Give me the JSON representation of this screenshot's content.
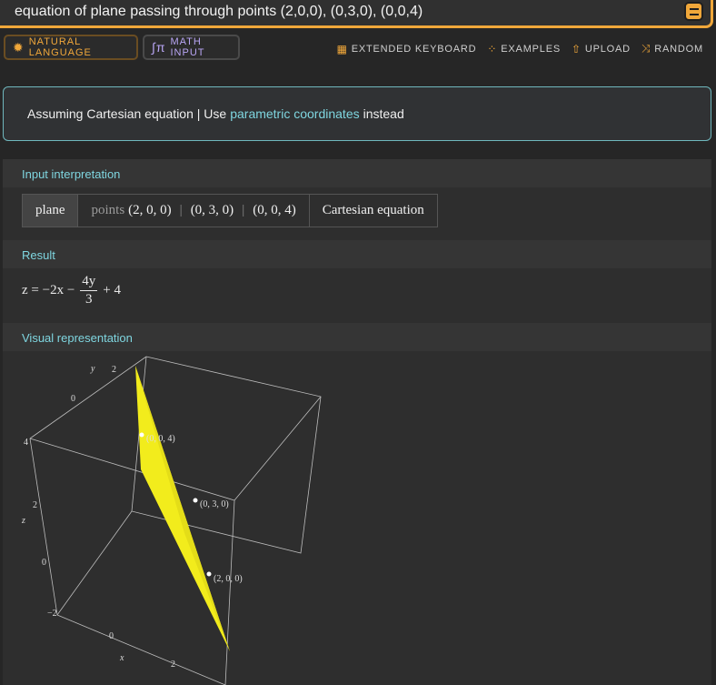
{
  "search": {
    "query": "equation of plane passing through points (2,0,0), (0,3,0), (0,0,4)"
  },
  "toolbar": {
    "natural_language": "NATURAL LANGUAGE",
    "math_input": "MATH INPUT",
    "extended_keyboard": "EXTENDED KEYBOARD",
    "examples": "EXAMPLES",
    "upload": "UPLOAD",
    "random": "RANDOM"
  },
  "assumption": {
    "prefix": "Assuming Cartesian equation | Use",
    "link": "parametric coordinates",
    "suffix": "instead"
  },
  "pods": {
    "input": {
      "title": "Input interpretation",
      "cells": {
        "plane": "plane",
        "points_word": "points",
        "p1": "(2, 0, 0)",
        "sep": "|",
        "p2": "(0, 3, 0)",
        "p3": "(0, 0, 4)",
        "cartesian": "Cartesian equation"
      }
    },
    "result": {
      "title": "Result",
      "lhs": "z = −2x −",
      "numerator": "4y",
      "denominator": "3",
      "rhs": "+ 4"
    },
    "visual": {
      "title": "Visual representation",
      "axis_labels": {
        "x": "x",
        "y": "y",
        "z": "z"
      },
      "ticks": {
        "y0": "0",
        "y2": "2",
        "z4": "4",
        "z2": "2",
        "z0": "0",
        "zm2": "−2",
        "x0": "0",
        "x2": "2"
      },
      "point_labels": {
        "a": "(0, 0, 4)",
        "b": "(0, 3, 0)",
        "c": "(2, 0, 0)"
      },
      "colors": {
        "plane": "#f2ec1c",
        "box": "#bdbdbd",
        "points": "#ffffff"
      }
    }
  }
}
